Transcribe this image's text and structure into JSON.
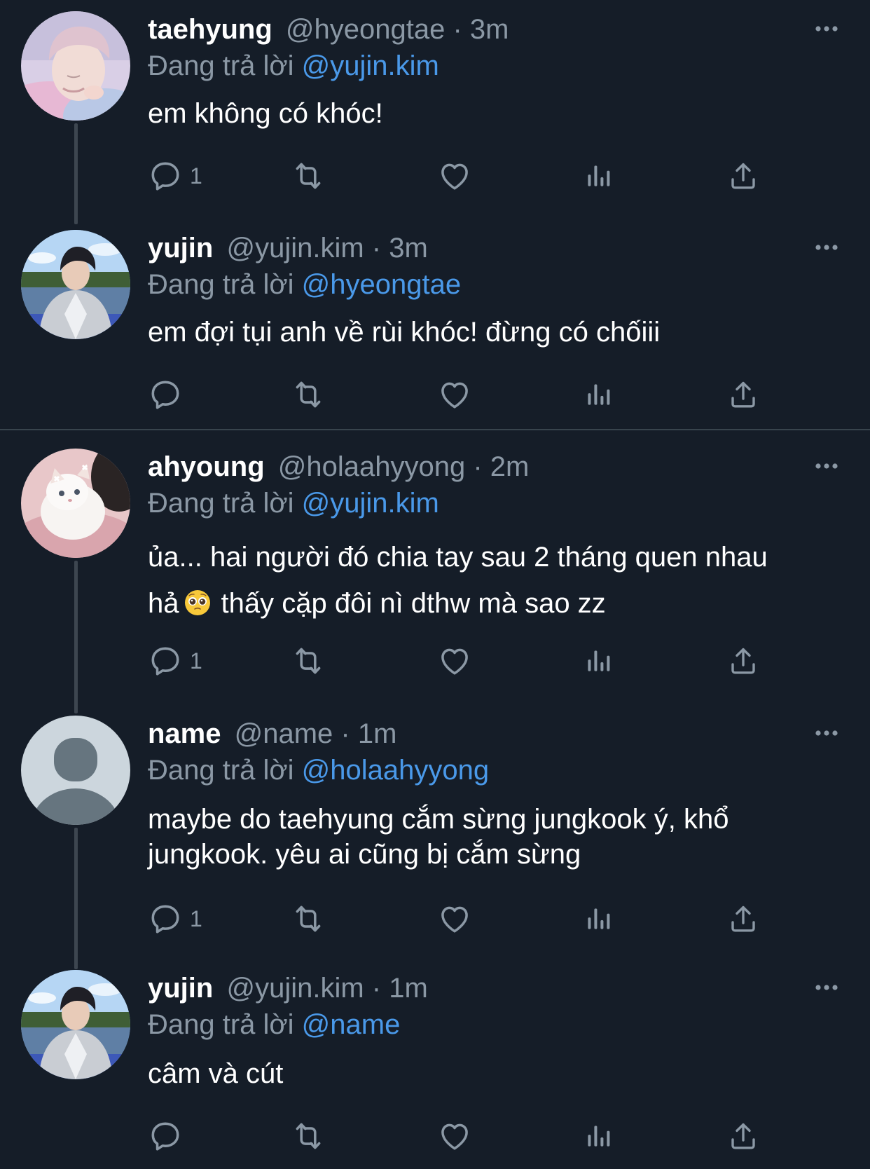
{
  "reply_label": "Đang trả lời",
  "tweets": [
    {
      "name": "taehyung",
      "handle_time": "@hyeongtae · 3m",
      "reply_to": "@yujin.kim",
      "text_lines": [
        "em không có khóc!"
      ],
      "reply_count": "1",
      "avatar": "pink-haired-man-photo"
    },
    {
      "name": "yujin",
      "handle_time": "@yujin.kim · 3m",
      "reply_to": "@hyeongtae",
      "text_lines": [
        "em đợi tụi anh về rùi khóc! đừng có chốiii"
      ],
      "reply_count": "",
      "avatar": "man-by-lake-photo"
    },
    {
      "name": "ahyoung",
      "handle_time": "@holaahyyong · 2m",
      "reply_to": "@yujin.kim",
      "text_lines": [
        "ủa... hai người đó chia tay sau 2 tháng quen nhau",
        "hả",
        "thấy cặp đôi nì dthw mà sao zz"
      ],
      "emoji": "pleading-face-emoji",
      "reply_count": "1",
      "avatar": "white-kitten-photo"
    },
    {
      "name": "name",
      "handle_time": "@name · 1m",
      "reply_to": "@holaahyyong",
      "text_lines": [
        "maybe do taehyung cắm sừng jungkook ý, khổ",
        "jungkook. yêu ai cũng bị cắm sừng"
      ],
      "reply_count": "1",
      "avatar": "default-profile-silhouette"
    },
    {
      "name": "yujin",
      "handle_time": "@yujin.kim · 1m",
      "reply_to": "@name",
      "text_lines": [
        "câm và cút"
      ],
      "reply_count": "",
      "avatar": "man-by-lake-photo"
    }
  ],
  "colors": {
    "background": "#151d28",
    "secondary_text": "#8b98a5",
    "mention": "#4a99e9",
    "thread_line": "#3d4650"
  },
  "icons": [
    "more-icon",
    "reply-icon",
    "retweet-icon",
    "like-icon",
    "views-icon",
    "share-icon"
  ]
}
